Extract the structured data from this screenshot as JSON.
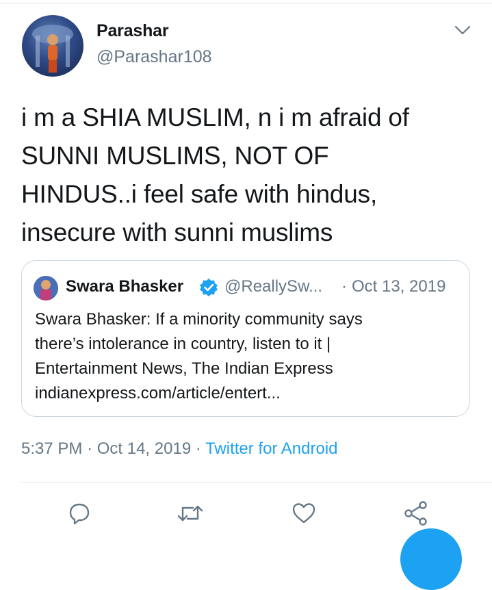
{
  "tweet": {
    "author": {
      "name": "Parashar",
      "handle": "@Parashar108"
    },
    "text": "i m a SHIA MUSLIM, n i m afraid of\nSUNNI MUSLIMS, NOT OF\nHINDUS..i feel safe with hindus,\ninsecure with sunni muslims",
    "quoted": {
      "name": "Swara Bhasker",
      "handle": "@ReallySw...",
      "separator": "·",
      "date": "Oct 13, 2019",
      "body": "Swara Bhasker: If a minority community says\nthere’s intolerance in country, listen to it |\nEntertainment News, The Indian Express\nindianexpress.com/article/entert..."
    },
    "time": "5:37 PM",
    "date": "Oct 14, 2019",
    "source": "Twitter for Android"
  },
  "colors": {
    "accent": "#1da1f2",
    "muted": "#657786",
    "border": "#ccd6dd"
  },
  "icons": [
    "chevron-down-icon",
    "verified-badge-icon",
    "reply-icon",
    "retweet-icon",
    "like-icon",
    "share-icon",
    "compose-icon"
  ]
}
